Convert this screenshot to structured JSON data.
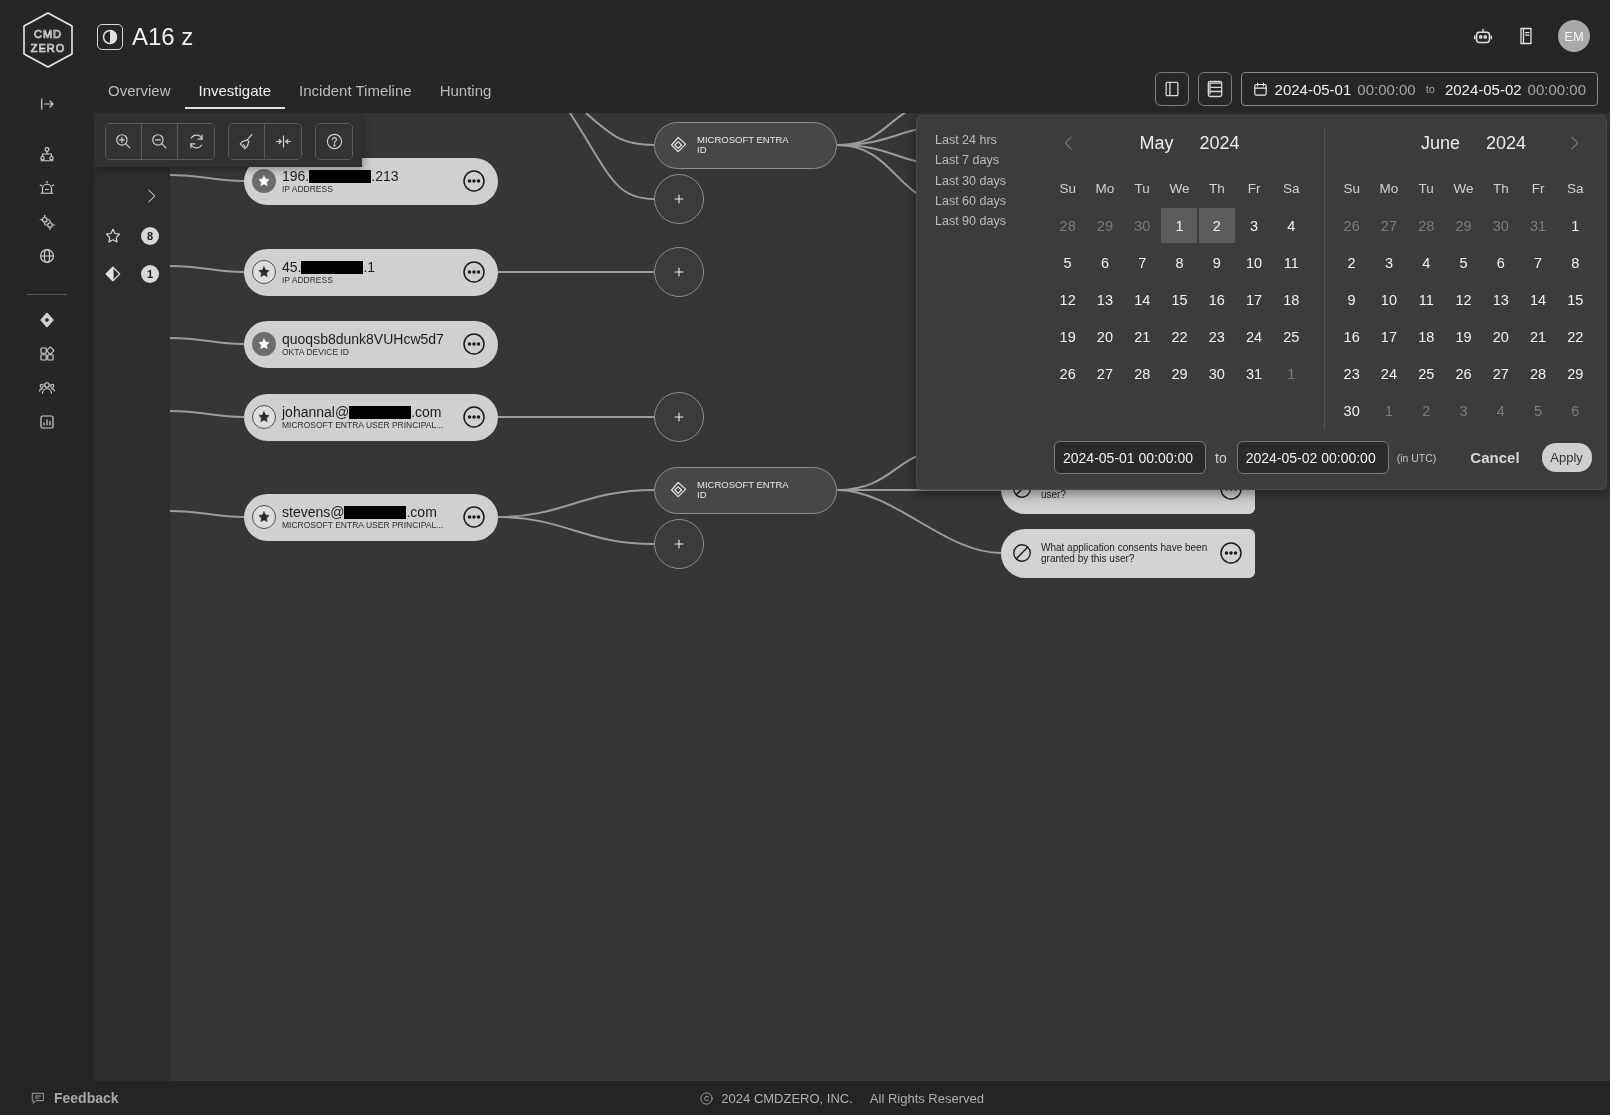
{
  "sidebar": {
    "logo": {
      "line_1": "CMD",
      "line_2": "ZERO"
    },
    "nav_items": [
      {
        "kind": "collapse"
      },
      {
        "kind": "network"
      },
      {
        "kind": "siren"
      },
      {
        "kind": "gears"
      },
      {
        "kind": "globe"
      },
      {
        "kind": "divider"
      },
      {
        "kind": "diamond"
      },
      {
        "kind": "apps"
      },
      {
        "kind": "people"
      },
      {
        "kind": "report"
      }
    ],
    "feedback": "Feedback"
  },
  "header": {
    "title": "A16 z",
    "tabs": [
      {
        "label": "Overview",
        "selected": false
      },
      {
        "label": "Investigate",
        "selected": true
      },
      {
        "label": "Incident Timeline",
        "selected": false
      },
      {
        "label": "Hunting",
        "selected": false
      }
    ],
    "avatar": "EM",
    "date_range": {
      "start_date": "2024-05-01",
      "start_time": "00:00:00",
      "separator": "to",
      "end_date": "2024-05-02",
      "end_time": "00:00:00"
    }
  },
  "canvas": {
    "filters": [
      {
        "kind": "star",
        "count": "8"
      },
      {
        "kind": "diamond",
        "count": "1"
      }
    ],
    "entities": [
      {
        "value": "196.",
        "value_end": ".213",
        "redacted": true,
        "type": "IP ADDRESS",
        "starred": true
      },
      {
        "value": "45.",
        "value_end": ".1",
        "redacted": true,
        "type": "IP ADDRESS",
        "starred": false
      },
      {
        "value": "quoqsb8dunk8VUHcw5d7",
        "redacted": false,
        "type": "OKTA DEVICE ID",
        "starred": true
      },
      {
        "value": "johannal@",
        "value_end": ".com",
        "redacted": true,
        "type": "MICROSOFT ENTRA USER PRINCIPAL...",
        "starred": false
      },
      {
        "value": "stevens@",
        "value_end": ".com",
        "redacted": true,
        "type": "MICROSOFT ENTRA USER PRINCIPAL...",
        "starred": false
      }
    ],
    "integrations": [
      {
        "label": "MICROSOFT ENTRA ID"
      },
      {
        "label": "MICROSOFT ENTRA ID"
      }
    ],
    "questions": [
      {
        "text": "user?"
      },
      {
        "text": "What application consents have been granted by this user?"
      }
    ]
  },
  "date_picker": {
    "presets": [
      "Last 24 hrs",
      "Last 7 days",
      "Last 30 days",
      "Last 60 days",
      "Last 90 days"
    ],
    "months": [
      {
        "month": "May",
        "year": "2024",
        "weekdays": [
          "Su",
          "Mo",
          "Tu",
          "We",
          "Th",
          "Fr",
          "Sa"
        ],
        "weeks": [
          [
            {
              "day": "28",
              "outside": true,
              "selected": false
            },
            {
              "day": "29",
              "outside": true,
              "selected": false
            },
            {
              "day": "30",
              "outside": true,
              "selected": false
            },
            {
              "day": "1",
              "outside": false,
              "selected": true
            },
            {
              "day": "2",
              "outside": false,
              "selected": true
            },
            {
              "day": "3",
              "outside": false,
              "selected": false
            },
            {
              "day": "4",
              "outside": false,
              "selected": false
            }
          ],
          [
            {
              "day": "5",
              "outside": false,
              "selected": false
            },
            {
              "day": "6",
              "outside": false,
              "selected": false
            },
            {
              "day": "7",
              "outside": false,
              "selected": false
            },
            {
              "day": "8",
              "outside": false,
              "selected": false
            },
            {
              "day": "9",
              "outside": false,
              "selected": false
            },
            {
              "day": "10",
              "outside": false,
              "selected": false
            },
            {
              "day": "11",
              "outside": false,
              "selected": false
            }
          ],
          [
            {
              "day": "12",
              "outside": false,
              "selected": false
            },
            {
              "day": "13",
              "outside": false,
              "selected": false
            },
            {
              "day": "14",
              "outside": false,
              "selected": false
            },
            {
              "day": "15",
              "outside": false,
              "selected": false
            },
            {
              "day": "16",
              "outside": false,
              "selected": false
            },
            {
              "day": "17",
              "outside": false,
              "selected": false
            },
            {
              "day": "18",
              "outside": false,
              "selected": false
            }
          ],
          [
            {
              "day": "19",
              "outside": false,
              "selected": false
            },
            {
              "day": "20",
              "outside": false,
              "selected": false
            },
            {
              "day": "21",
              "outside": false,
              "selected": false
            },
            {
              "day": "22",
              "outside": false,
              "selected": false
            },
            {
              "day": "23",
              "outside": false,
              "selected": false
            },
            {
              "day": "24",
              "outside": false,
              "selected": false
            },
            {
              "day": "25",
              "outside": false,
              "selected": false
            }
          ],
          [
            {
              "day": "26",
              "outside": false,
              "selected": false
            },
            {
              "day": "27",
              "outside": false,
              "selected": false
            },
            {
              "day": "28",
              "outside": false,
              "selected": false
            },
            {
              "day": "29",
              "outside": false,
              "selected": false
            },
            {
              "day": "30",
              "outside": false,
              "selected": false
            },
            {
              "day": "31",
              "outside": false,
              "selected": false
            },
            {
              "day": "1",
              "outside": true,
              "selected": false
            }
          ]
        ]
      },
      {
        "month": "June",
        "year": "2024",
        "weekdays": [
          "Su",
          "Mo",
          "Tu",
          "We",
          "Th",
          "Fr",
          "Sa"
        ],
        "weeks": [
          [
            {
              "day": "26",
              "outside": true,
              "selected": false
            },
            {
              "day": "27",
              "outside": true,
              "selected": false
            },
            {
              "day": "28",
              "outside": true,
              "selected": false
            },
            {
              "day": "29",
              "outside": true,
              "selected": false
            },
            {
              "day": "30",
              "outside": true,
              "selected": false
            },
            {
              "day": "31",
              "outside": true,
              "selected": false
            },
            {
              "day": "1",
              "outside": false,
              "selected": false
            }
          ],
          [
            {
              "day": "2",
              "outside": false,
              "selected": false
            },
            {
              "day": "3",
              "outside": false,
              "selected": false
            },
            {
              "day": "4",
              "outside": false,
              "selected": false
            },
            {
              "day": "5",
              "outside": false,
              "selected": false
            },
            {
              "day": "6",
              "outside": false,
              "selected": false
            },
            {
              "day": "7",
              "outside": false,
              "selected": false
            },
            {
              "day": "8",
              "outside": false,
              "selected": false
            }
          ],
          [
            {
              "day": "9",
              "outside": false,
              "selected": false
            },
            {
              "day": "10",
              "outside": false,
              "selected": false
            },
            {
              "day": "11",
              "outside": false,
              "selected": false
            },
            {
              "day": "12",
              "outside": false,
              "selected": false
            },
            {
              "day": "13",
              "outside": false,
              "selected": false
            },
            {
              "day": "14",
              "outside": false,
              "selected": false
            },
            {
              "day": "15",
              "outside": false,
              "selected": false
            }
          ],
          [
            {
              "day": "16",
              "outside": false,
              "selected": false
            },
            {
              "day": "17",
              "outside": false,
              "selected": false
            },
            {
              "day": "18",
              "outside": false,
              "selected": false
            },
            {
              "day": "19",
              "outside": false,
              "selected": false
            },
            {
              "day": "20",
              "outside": false,
              "selected": false
            },
            {
              "day": "21",
              "outside": false,
              "selected": false
            },
            {
              "day": "22",
              "outside": false,
              "selected": false
            }
          ],
          [
            {
              "day": "23",
              "outside": false,
              "selected": false
            },
            {
              "day": "24",
              "outside": false,
              "selected": false
            },
            {
              "day": "25",
              "outside": false,
              "selected": false
            },
            {
              "day": "26",
              "outside": false,
              "selected": false
            },
            {
              "day": "27",
              "outside": false,
              "selected": false
            },
            {
              "day": "28",
              "outside": false,
              "selected": false
            },
            {
              "day": "29",
              "outside": false,
              "selected": false
            }
          ],
          [
            {
              "day": "30",
              "outside": false,
              "selected": false
            },
            {
              "day": "1",
              "outside": true,
              "selected": false
            },
            {
              "day": "2",
              "outside": true,
              "selected": false
            },
            {
              "day": "3",
              "outside": true,
              "selected": false
            },
            {
              "day": "4",
              "outside": true,
              "selected": false
            },
            {
              "day": "5",
              "outside": true,
              "selected": false
            },
            {
              "day": "6",
              "outside": true,
              "selected": false
            }
          ]
        ]
      }
    ],
    "start": "2024-05-01 00:00:00",
    "separator": "to",
    "end": "2024-05-02 00:00:00",
    "timezone": "(in UTC)",
    "cancel": "Cancel",
    "apply": "Apply"
  },
  "footer": {
    "copyright": "2024 CMDZERO, INC.",
    "rights": "All Rights Reserved"
  }
}
